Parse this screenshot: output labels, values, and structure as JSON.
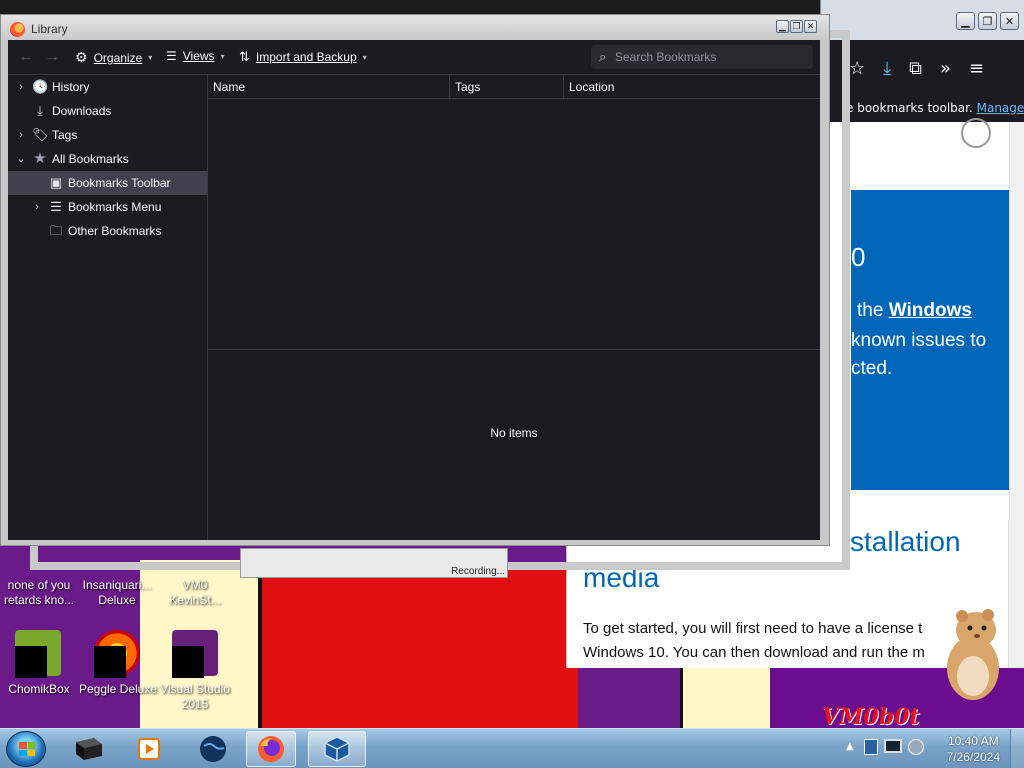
{
  "library": {
    "window_title": "Library",
    "toolbar": {
      "back": "←",
      "forward": "→",
      "organize": "Organize",
      "views": "Views",
      "import_backup": "Import and Backup",
      "search_placeholder": "Search Bookmarks"
    },
    "sidebar": [
      {
        "label": "History",
        "twisty": "›",
        "icon": "clock-icon",
        "glyph": "🕓"
      },
      {
        "label": "Downloads",
        "twisty": "",
        "icon": "download-icon",
        "glyph": "⤓"
      },
      {
        "label": "Tags",
        "twisty": "›",
        "icon": "tag-icon",
        "glyph": "🏷"
      },
      {
        "label": "All Bookmarks",
        "twisty": "⌄",
        "icon": "star-icon",
        "glyph": "★"
      },
      {
        "label": "Bookmarks Toolbar",
        "twisty": "",
        "icon": "bookmarks-toolbar-icon",
        "glyph": "▣",
        "selected": true
      },
      {
        "label": "Bookmarks Menu",
        "twisty": "›",
        "icon": "bookmarks-menu-icon",
        "glyph": "☰"
      },
      {
        "label": "Other Bookmarks",
        "twisty": "",
        "icon": "folder-icon",
        "glyph": "🗀"
      }
    ],
    "columns": [
      "Name",
      "Tags",
      "Location"
    ],
    "details_empty": "No items"
  },
  "browser_bg": {
    "infobar_text": "e bookmarks toolbar.",
    "infobar_link": "Manage bo",
    "hero_number": "0",
    "hero_line1_prefix": "the",
    "hero_line1_bold": "Windows",
    "hero_line2": "known issues to",
    "hero_line3": "cted.",
    "heading_line1": "stallation",
    "heading_line2": "media",
    "para_line1": "To get started, you will first need to have a license t",
    "para_line2": "Windows 10. You can then download and run the m"
  },
  "desktop": {
    "icons": [
      {
        "label": "none of you retards kno..."
      },
      {
        "label": "Insaniquari... Deluxe"
      },
      {
        "label": "VM0 KevinSt..."
      },
      {
        "label": "ChomikBox"
      },
      {
        "label": "Peggle Deluxe"
      },
      {
        "label": "Visual Studio 2015"
      }
    ],
    "wallpaper_text": "VM0b0t",
    "recording_text": "Recording..."
  },
  "taskbar": {
    "time": "10:40 AM",
    "date": "7/26/2024",
    "items": [
      "terminal-icon",
      "media-player-icon",
      "globe-icon",
      "firefox-icon",
      "virtualbox-icon"
    ]
  },
  "colors": {
    "library_bg": "#1c1b22",
    "selected_row": "#42414d",
    "ms_blue": "#0067b8"
  }
}
